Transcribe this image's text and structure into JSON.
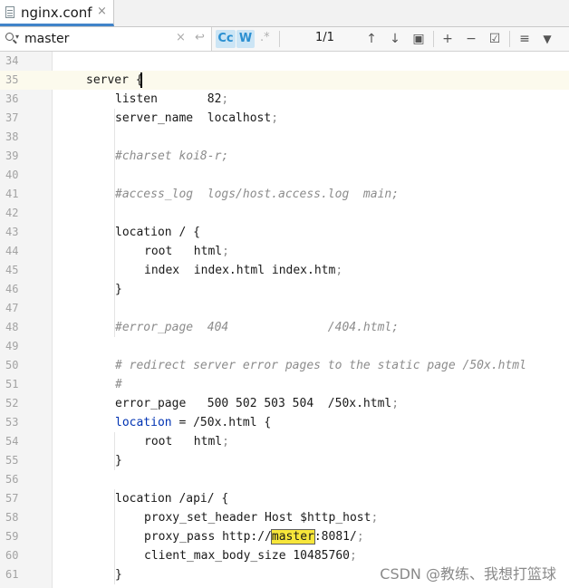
{
  "tab": {
    "title": "nginx.conf",
    "close_glyph": "×",
    "icon": "file-icon"
  },
  "search": {
    "value": "master",
    "dropdown_glyph": "▾",
    "clear_glyph": "×",
    "replace_glyph": "↩",
    "match_case_label": "Cc",
    "whole_words_label": "W",
    "regex_label": ".*",
    "match_count": "1/1"
  },
  "toolbar": {
    "prev_glyph": "↑",
    "next_glyph": "↓",
    "context_glyph": "▣",
    "add_glyph": "+",
    "remove_glyph": "−",
    "select_glyph": "☑",
    "multiline_glyph": "≡",
    "filter_glyph": "▼"
  },
  "editor": {
    "colors": {
      "keyword": "#0033b3",
      "comment": "#8c8c8c",
      "highlight": "#f7e63a",
      "current_line": "#fcfaed"
    },
    "lines": [
      {
        "n": "34",
        "indent": 0,
        "parts": []
      },
      {
        "n": "35",
        "indent": 1,
        "parts": [
          {
            "t": "server {",
            "c": ""
          }
        ],
        "current": true
      },
      {
        "n": "36",
        "indent": 2,
        "parts": [
          {
            "t": "listen       82",
            "c": ""
          },
          {
            "t": ";",
            "c": "semi"
          }
        ]
      },
      {
        "n": "37",
        "indent": 2,
        "parts": [
          {
            "t": "server_name  localhost",
            "c": ""
          },
          {
            "t": ";",
            "c": "semi"
          }
        ]
      },
      {
        "n": "38",
        "indent": 0,
        "parts": []
      },
      {
        "n": "39",
        "indent": 2,
        "parts": [
          {
            "t": "#charset koi8-r;",
            "c": "cm"
          }
        ]
      },
      {
        "n": "40",
        "indent": 0,
        "parts": []
      },
      {
        "n": "41",
        "indent": 2,
        "parts": [
          {
            "t": "#access_log  logs/host.access.log  main;",
            "c": "cm"
          }
        ]
      },
      {
        "n": "42",
        "indent": 0,
        "parts": []
      },
      {
        "n": "43",
        "indent": 2,
        "parts": [
          {
            "t": "location / {",
            "c": ""
          }
        ]
      },
      {
        "n": "44",
        "indent": 3,
        "parts": [
          {
            "t": "root   html",
            "c": ""
          },
          {
            "t": ";",
            "c": "semi"
          }
        ]
      },
      {
        "n": "45",
        "indent": 3,
        "parts": [
          {
            "t": "index  index.html index.htm",
            "c": ""
          },
          {
            "t": ";",
            "c": "semi"
          }
        ]
      },
      {
        "n": "46",
        "indent": 2,
        "parts": [
          {
            "t": "}",
            "c": ""
          }
        ]
      },
      {
        "n": "47",
        "indent": 0,
        "parts": []
      },
      {
        "n": "48",
        "indent": 2,
        "parts": [
          {
            "t": "#error_page  404              /404.html;",
            "c": "cm"
          }
        ]
      },
      {
        "n": "49",
        "indent": 0,
        "parts": []
      },
      {
        "n": "50",
        "indent": 2,
        "parts": [
          {
            "t": "# redirect server error pages to the static page /50x.html",
            "c": "cm"
          }
        ]
      },
      {
        "n": "51",
        "indent": 2,
        "parts": [
          {
            "t": "#",
            "c": "cm"
          }
        ]
      },
      {
        "n": "52",
        "indent": 2,
        "parts": [
          {
            "t": "error_page   500 502 503 504  /50x.html",
            "c": ""
          },
          {
            "t": ";",
            "c": "semi"
          }
        ]
      },
      {
        "n": "53",
        "indent": 2,
        "parts": [
          {
            "t": "location",
            "c": "kw"
          },
          {
            "t": " = /50x.html {",
            "c": ""
          }
        ]
      },
      {
        "n": "54",
        "indent": 3,
        "parts": [
          {
            "t": "root   html",
            "c": ""
          },
          {
            "t": ";",
            "c": "semi"
          }
        ]
      },
      {
        "n": "55",
        "indent": 2,
        "parts": [
          {
            "t": "}",
            "c": ""
          }
        ]
      },
      {
        "n": "56",
        "indent": 0,
        "parts": []
      },
      {
        "n": "57",
        "indent": 2,
        "parts": [
          {
            "t": "location /api/ {",
            "c": ""
          }
        ]
      },
      {
        "n": "58",
        "indent": 3,
        "parts": [
          {
            "t": "proxy_set_header Host $http_host",
            "c": ""
          },
          {
            "t": ";",
            "c": "semi"
          }
        ]
      },
      {
        "n": "59",
        "indent": 3,
        "parts": [
          {
            "t": "proxy_pass http://",
            "c": ""
          },
          {
            "t": "master",
            "c": "hit"
          },
          {
            "t": ":8081/",
            "c": ""
          },
          {
            "t": ";",
            "c": "semi"
          }
        ]
      },
      {
        "n": "60",
        "indent": 3,
        "parts": [
          {
            "t": "client_max_body_size 10485760",
            "c": ""
          },
          {
            "t": ";",
            "c": "semi"
          }
        ]
      },
      {
        "n": "61",
        "indent": 2,
        "parts": [
          {
            "t": "}",
            "c": ""
          }
        ]
      }
    ]
  },
  "watermark": "CSDN @教练、我想打篮球"
}
